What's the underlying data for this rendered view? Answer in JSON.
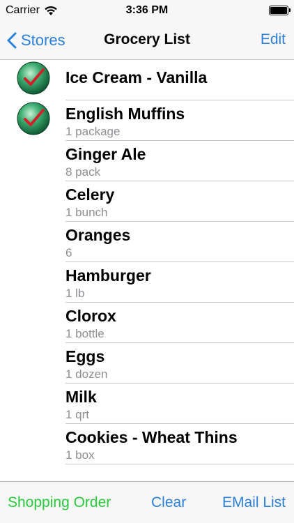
{
  "status_bar": {
    "carrier": "Carrier",
    "time": "3:36 PM"
  },
  "nav": {
    "back_label": "Stores",
    "title": "Grocery List",
    "edit_label": "Edit"
  },
  "items": [
    {
      "name": "Ice Cream - Vanilla",
      "qty": "",
      "checked": true
    },
    {
      "name": "English Muffins",
      "qty": "1 package",
      "checked": true
    },
    {
      "name": "Ginger Ale",
      "qty": "8 pack",
      "checked": false
    },
    {
      "name": "Celery",
      "qty": "1 bunch",
      "checked": false
    },
    {
      "name": "Oranges",
      "qty": "6",
      "checked": false
    },
    {
      "name": "Hamburger",
      "qty": "1 lb",
      "checked": false
    },
    {
      "name": "Clorox",
      "qty": "1 bottle",
      "checked": false
    },
    {
      "name": "Eggs",
      "qty": "1 dozen",
      "checked": false
    },
    {
      "name": "Milk",
      "qty": "1 qrt",
      "checked": false
    },
    {
      "name": "Cookies - Wheat Thins",
      "qty": "1 box",
      "checked": false
    }
  ],
  "toolbar": {
    "shopping_order_label": "Shopping Order",
    "clear_label": "Clear",
    "email_label": "EMail List"
  },
  "colors": {
    "accent": "#2b7fd9",
    "shopping_order": "#28c83a",
    "separator": "#c8c7cc",
    "secondary_text": "#8e8e93",
    "check_ball": "#1f8a55",
    "check_mark": "#d0202a"
  },
  "icons": {
    "back": "chevron-left-icon",
    "checked": "checkmark-ball-icon",
    "wifi": "wifi-icon",
    "battery": "battery-icon"
  }
}
